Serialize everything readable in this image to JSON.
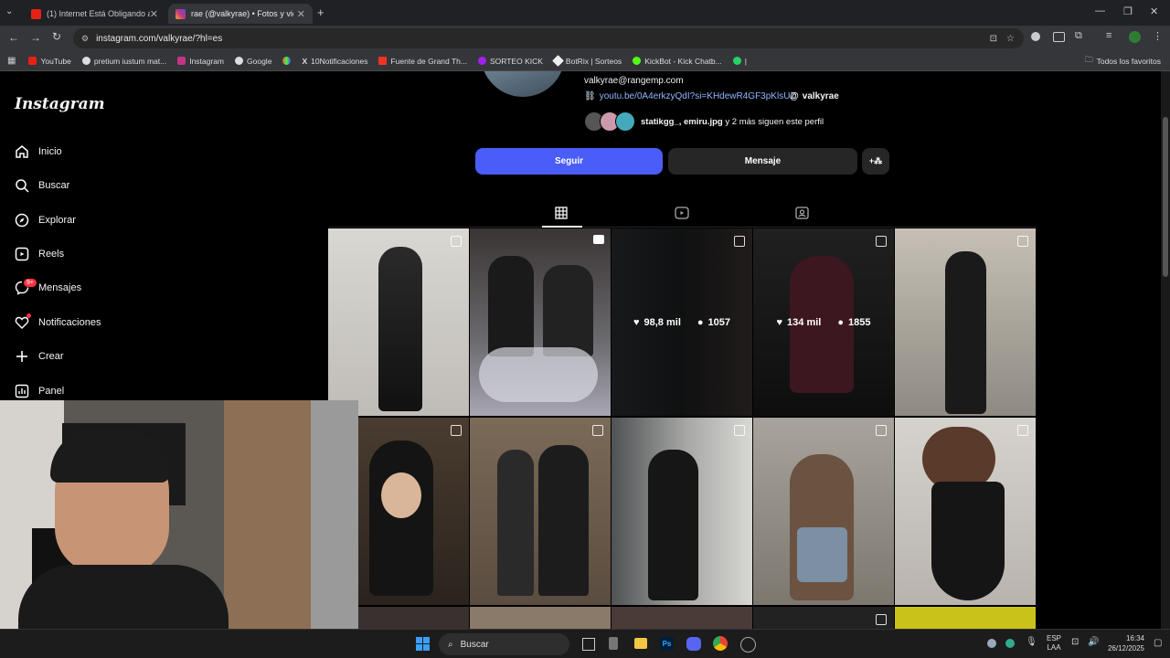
{
  "browser": {
    "tabs": [
      {
        "title": "(1) Internet Está Obligando a La",
        "active": false
      },
      {
        "title": "rae (@valkyrae) • Fotos y videos",
        "active": true
      }
    ],
    "url": "instagram.com/valkyrae/?hl=es",
    "bookmarks": [
      "YouTube",
      "pretium iustum mat...",
      "Instagram",
      "Google",
      "10Notificaciones",
      "Fuente de Grand Th...",
      "SORTEO KICK",
      "BotRix | Sorteos",
      "KickBot - Kick Chatb...",
      "Todos los favoritos"
    ]
  },
  "instagram": {
    "logo": "Instagram",
    "nav": [
      {
        "label": "Inicio",
        "icon": "home-icon"
      },
      {
        "label": "Buscar",
        "icon": "search-icon"
      },
      {
        "label": "Explorar",
        "icon": "compass-icon"
      },
      {
        "label": "Reels",
        "icon": "reels-icon"
      },
      {
        "label": "Mensajes",
        "icon": "messenger-icon",
        "badge": "9+"
      },
      {
        "label": "Notificaciones",
        "icon": "heart-icon"
      },
      {
        "label": "Crear",
        "icon": "plus-icon"
      },
      {
        "label": "Panel",
        "icon": "dashboard-icon"
      }
    ],
    "profile": {
      "email": "valkyrae@rangemp.com",
      "link": "youtu.be/0A4erkzyQdI?si=KHdewR4GF3pKlsUZ",
      "threads": "valkyrae",
      "followed_by_names": "statikgg_, emiru.jpg",
      "followed_by_rest": " y 2 más siguen este perfil"
    },
    "buttons": {
      "follow": "Seguir",
      "message": "Mensaje"
    },
    "hover_post": {
      "likes": "98,8 mil",
      "comments": "1057"
    },
    "hover_post2": {
      "likes": "134 mil",
      "comments": "1855"
    }
  },
  "taskbar": {
    "search": "Buscar",
    "lang": "ESP",
    "lang2": "LAA",
    "time": "16:34",
    "date": "26/12/2025"
  }
}
